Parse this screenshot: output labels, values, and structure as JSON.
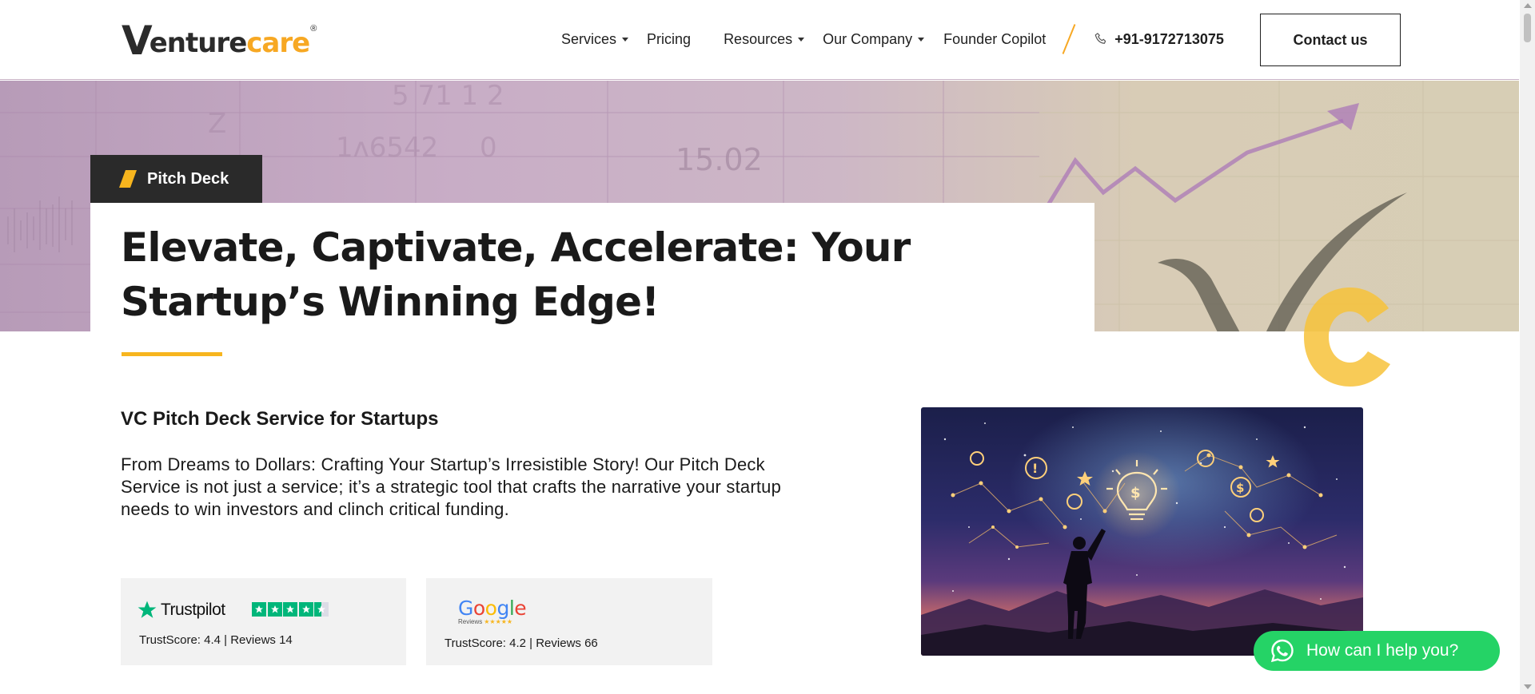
{
  "logo": {
    "v": "V",
    "enture": "enture",
    "care": "care",
    "reg": "®"
  },
  "nav": {
    "items": [
      {
        "label": "Services",
        "dropdown": true
      },
      {
        "label": "Pricing",
        "dropdown": false
      },
      {
        "label": "Resources",
        "dropdown": true
      },
      {
        "label": "Our Company",
        "dropdown": true
      },
      {
        "label": "Founder Copilot",
        "dropdown": false
      }
    ],
    "phone": "+91-9172713075",
    "contact_label": "Contact us"
  },
  "hero": {
    "tag": "Pitch Deck",
    "title": "Elevate, Captivate, Accelerate: Your Startup’s Winning Edge!",
    "bg_ticker": "15.02"
  },
  "content": {
    "subtitle": "VC Pitch Deck Service for Startups",
    "description": "From Dreams to Dollars: Crafting Your Startup’s Irresistible Story! Our Pitch Deck Service is not just a service; it’s a strategic tool that crafts the narrative your startup needs to win investors and clinch critical funding."
  },
  "reviews": {
    "trustpilot": {
      "name": "Trustpilot",
      "score_text": "TrustScore: 4.4 | Reviews 14",
      "rating": 4.4
    },
    "google": {
      "word": [
        "G",
        "o",
        "o",
        "g",
        "l",
        "e"
      ],
      "sub": "Reviews",
      "stars": "★★★★★",
      "score_text": "TrustScore: 4.2 | Reviews 66"
    }
  },
  "whatsapp": {
    "label": "How can I help you?"
  },
  "colors": {
    "accent": "#f7b51e",
    "dark": "#2a2a2a",
    "whatsapp": "#25d366",
    "trustpilot": "#00b67a"
  },
  "icons": [
    "phone-icon",
    "caret-down-icon",
    "whatsapp-icon",
    "trustpilot-star-icon",
    "vc-check-logo"
  ]
}
